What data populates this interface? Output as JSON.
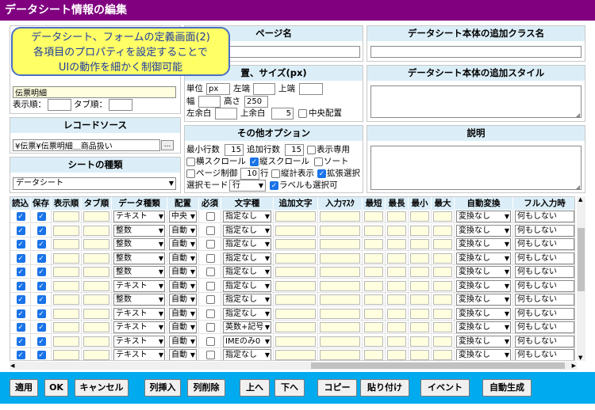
{
  "window": {
    "title": "データシート情報の編集"
  },
  "callout": {
    "text": "データシート、フォームの定義画面(2)\n各項目のプロパティを設定することで\nUIの動作を細かく制御可能"
  },
  "left": {
    "name_value": "伝票明細",
    "order_label": "表示順：",
    "order_value": "",
    "tab_order_label": "タブ順：",
    "tab_order_value": "",
    "record_source_title": "レコードソース",
    "record_source_value": "¥伝票¥伝票明細＿商品扱い",
    "browse_label": "...",
    "sheet_type_title": "シートの種類",
    "sheet_type_value": "データシート"
  },
  "page_name": {
    "title": "ページ名",
    "value": ""
  },
  "position": {
    "title": "置、サイズ(px)",
    "unit_label": "単位",
    "unit_value": "px",
    "left_label": "左端",
    "left_value": "",
    "top_label": "上端",
    "top_value": "",
    "width_label": "幅",
    "width_value": "",
    "height_label": "高さ",
    "height_value": "250",
    "left_margin_label": "左余白",
    "left_margin_value": "",
    "top_margin_label": "上余白",
    "top_margin_value": "5",
    "center_label": "中央配置"
  },
  "options": {
    "title": "その他オプション",
    "min_rows_label": "最小行数",
    "min_rows_value": "15",
    "add_rows_label": "追加行数",
    "add_rows_value": "15",
    "readonly_label": "表示専用",
    "hscroll_label": "横スクロール",
    "vscroll_label": "縦スクロール",
    "sort_label": "ソート",
    "page_ctrl_label": "ページ制御",
    "page_rows_value": "10",
    "rows_unit": "行",
    "vtotal_label": "縦計表示",
    "extsel_label": "拡張選択",
    "selmode_label": "選択モード",
    "selmode_value": "行",
    "labelsel_label": "ラベルも選択可"
  },
  "class_panel": {
    "title": "データシート本体の追加クラス名",
    "value": ""
  },
  "style_panel": {
    "title": "データシート本体の追加スタイル",
    "value": ""
  },
  "desc_panel": {
    "title": "説明",
    "value": ""
  },
  "grid": {
    "headers": [
      "読込",
      "保存",
      "表示順",
      "タブ順",
      "データ種類",
      "配置",
      "必須",
      "文字種",
      "追加文字",
      "入力ﾏｽｸ",
      "最短",
      "最長",
      "最小",
      "最大",
      "自動変換",
      "フル入力時"
    ],
    "rows": [
      {
        "type": "テキスト",
        "align": "中央",
        "chars": "指定なし",
        "conv": "変換なし",
        "full": "何もしない"
      },
      {
        "type": "整数",
        "align": "自動",
        "chars": "指定なし",
        "conv": "変換なし",
        "full": "何もしない"
      },
      {
        "type": "整数",
        "align": "自動",
        "chars": "指定なし",
        "conv": "変換なし",
        "full": "何もしない"
      },
      {
        "type": "整数",
        "align": "自動",
        "chars": "指定なし",
        "conv": "変換なし",
        "full": "何もしない"
      },
      {
        "type": "整数",
        "align": "自動",
        "chars": "指定なし",
        "conv": "変換なし",
        "full": "何もしない"
      },
      {
        "type": "テキスト",
        "align": "自動",
        "chars": "指定なし",
        "conv": "変換なし",
        "full": "何もしない"
      },
      {
        "type": "整数",
        "align": "自動",
        "chars": "指定なし",
        "conv": "変換なし",
        "full": "何もしない"
      },
      {
        "type": "テキスト",
        "align": "自動",
        "chars": "指定なし",
        "conv": "変換なし",
        "full": "何もしない"
      },
      {
        "type": "テキスト",
        "align": "自動",
        "chars": "英数+記号",
        "conv": "変換なし",
        "full": "何もしない"
      },
      {
        "type": "テキスト",
        "align": "自動",
        "chars": "IMEのみ0",
        "conv": "変換なし",
        "full": "何もしない"
      },
      {
        "type": "テキスト",
        "align": "自動",
        "chars": "指定なし",
        "conv": "変換なし",
        "full": "何もしない"
      }
    ]
  },
  "buttons": {
    "apply": "適用",
    "ok": "OK",
    "cancel": "キャンセル",
    "col_insert": "列挿入",
    "col_delete": "列削除",
    "up": "上へ",
    "down": "下へ",
    "copy": "コピー",
    "paste": "貼り付け",
    "event": "イベント",
    "autogen": "自動生成"
  }
}
